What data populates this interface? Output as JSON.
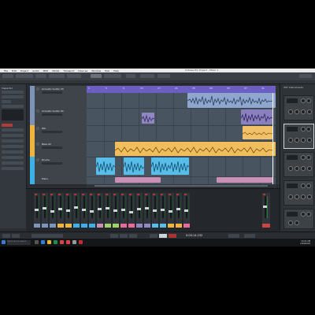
{
  "app": {
    "menu": [
      "File",
      "Edit",
      "Project",
      "Audio",
      "MIDI",
      "Media",
      "Transport",
      "Devices",
      "Window",
      "Hub",
      "Help"
    ],
    "window_title": "Cubase Pro Project - Mixer 1"
  },
  "inspector": {
    "title": "Inspector"
  },
  "tracks": [
    {
      "name": "Acoustic Guitar 03",
      "color": "#7e93b8"
    },
    {
      "name": "Acoustic Guitar 04",
      "color": "#7e93b8"
    },
    {
      "name": "Mix",
      "color": "#f0b43e"
    },
    {
      "name": "Bass 02",
      "color": "#f0b43e"
    },
    {
      "name": "Drums",
      "color": "#3fb0e6"
    },
    {
      "name": "Piano",
      "color": "#3fb0e6"
    }
  ],
  "ruler": {
    "marks": [
      "1",
      "5",
      "9",
      "13",
      "17",
      "21",
      "25",
      "29",
      "33",
      "37",
      "41"
    ]
  },
  "right_rack": {
    "title": "VST Instruments"
  },
  "transport": {
    "time": "0:00:14.232"
  },
  "taskbar": {
    "search_placeholder": "Type here to search",
    "time": "10:24 AM",
    "date": "2/28/2018"
  },
  "colors": {
    "ruler": "#6b5fc4",
    "arrange_bg": "#485460",
    "accent_orange": "#f0b43e",
    "accent_blue": "#3fb0e6",
    "accent_steel": "#7e93b8"
  }
}
